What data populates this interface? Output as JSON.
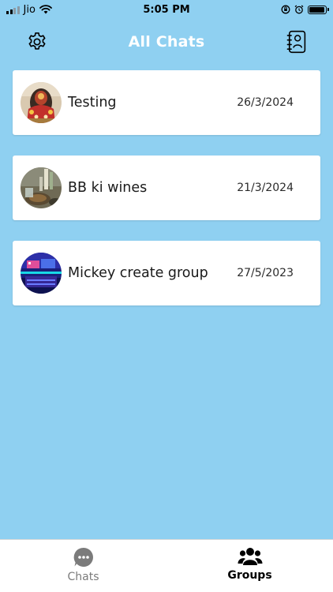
{
  "status_bar": {
    "carrier": "Jio",
    "time": "5:05 PM",
    "battery_level": 0.95
  },
  "header": {
    "title": "All Chats",
    "left_icon": "gear-icon",
    "right_icon": "contacts-book-icon"
  },
  "chats": [
    {
      "name": "Testing",
      "date": "26/3/2024",
      "avatar": "deity-photo"
    },
    {
      "name": "BB ki wines",
      "date": "21/3/2024",
      "avatar": "drinks-photo"
    },
    {
      "name": "Mickey create group",
      "date": "27/5/2023",
      "avatar": "neon-room-photo"
    }
  ],
  "tab_bar": {
    "tabs": [
      {
        "label": "Chats",
        "icon": "chat-bubble-icon",
        "active": false
      },
      {
        "label": "Groups",
        "icon": "group-icon",
        "active": true
      }
    ]
  },
  "colors": {
    "background": "#8fd0f1",
    "card": "#ffffff",
    "header_text": "#ffffff",
    "inactive_tab": "#7b7b7b",
    "active_tab": "#000000"
  }
}
